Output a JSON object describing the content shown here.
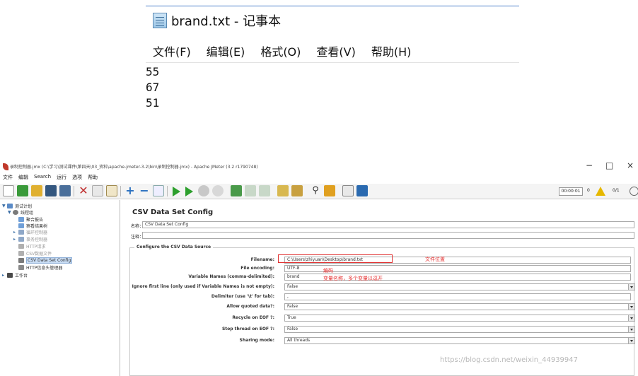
{
  "notepad": {
    "title": "brand.txt - 记事本",
    "menu": [
      "文件(F)",
      "编辑(E)",
      "格式(O)",
      "查看(V)",
      "帮助(H)"
    ],
    "lines": [
      "55",
      "67",
      "51"
    ]
  },
  "jmeter": {
    "title": "录制控制器.jmx (C:\\学习\\测试课件\\第四天\\03_资料\\apache-jmeter-3.2\\bin\\录制控制器.jmx) - Apache JMeter (3.2 r1790748)",
    "window_controls": [
      "−",
      "□",
      "×"
    ],
    "menu": [
      "文件",
      "编辑",
      "Search",
      "运行",
      "选项",
      "帮助"
    ],
    "toolbar": {
      "timer": "00:00:01",
      "warning_count": "0",
      "threads": "0/1"
    },
    "tree": [
      {
        "label": "测试计划",
        "icon": "test-plan-icon",
        "color": "#5a8ac6",
        "toggle": "▼"
      },
      {
        "label": "线程组",
        "icon": "gear-icon",
        "color": "#7a7a7a",
        "toggle": "▼"
      },
      {
        "label": "聚合报告",
        "icon": "report-icon",
        "color": "#6f9fd8",
        "toggle": ""
      },
      {
        "label": "察看结果树",
        "icon": "report-icon",
        "color": "#6f9fd8",
        "toggle": ""
      },
      {
        "label": "循环控制器",
        "icon": "controller-icon",
        "color": "#8fa8c8",
        "toggle": "▸"
      },
      {
        "label": "事务控制器",
        "icon": "controller-icon",
        "color": "#8fa8c8",
        "toggle": "▸"
      },
      {
        "label": "HTTP请求",
        "icon": "sampler-icon",
        "color": "#b0b0b0",
        "toggle": ""
      },
      {
        "label": "CSV数据文件",
        "icon": "config-icon",
        "color": "#b0b0b0",
        "toggle": ""
      },
      {
        "label": "CSV Data Set Config",
        "icon": "csv-config-icon",
        "color": "#7a7a7a",
        "toggle": ""
      },
      {
        "label": "HTTP信息头管理器",
        "icon": "config-icon",
        "color": "#8a8a8a",
        "toggle": ""
      },
      {
        "label": "工作台",
        "icon": "workbench-icon",
        "color": "#4a4a4a",
        "toggle": "▸"
      }
    ],
    "panel": {
      "title": "CSV Data Set Config",
      "name_label": "名称：",
      "name_value": "CSV Data Set Config",
      "comment_label": "注释：",
      "comment_value": "",
      "group_title": "Configure the CSV Data Source",
      "fields": [
        {
          "label": "Filename:",
          "value": "C:\\Users\\zhiyuan\\Desktop\\brand.txt",
          "dropdown": false
        },
        {
          "label": "File encoding:",
          "value": "UTF-8",
          "dropdown": false
        },
        {
          "label": "Variable Names (comma-delimited):",
          "value": "brand",
          "dropdown": false
        },
        {
          "label": "Ignore first line (only used if Variable Names is not empty):",
          "value": "False",
          "dropdown": true
        },
        {
          "label": "Delimiter (use '\\t' for tab):",
          "value": ",",
          "dropdown": false
        },
        {
          "label": "Allow quoted data?:",
          "value": "False",
          "dropdown": true
        },
        {
          "label": "Recycle on EOF ?:",
          "value": "True",
          "dropdown": true
        },
        {
          "label": "Stop thread on EOF ?:",
          "value": "False",
          "dropdown": true
        },
        {
          "label": "Sharing mode:",
          "value": "All threads",
          "dropdown": true
        }
      ],
      "annotations": {
        "file_location": "文件位置",
        "encoding": "编码",
        "variable_names": "变量名称，多个变量以逗开"
      },
      "annotation_color": "#e53030"
    }
  },
  "watermark": "https://blog.csdn.net/weixin_44939947"
}
